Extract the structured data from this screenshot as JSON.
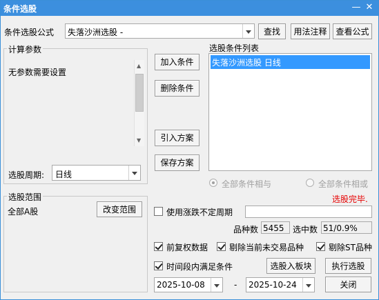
{
  "window": {
    "title": "条件选股",
    "min_icon": "minimize-icon",
    "close_icon": "close-icon"
  },
  "formula": {
    "label": "条件选股公式",
    "value": "失落沙洲选股  -",
    "find_button": "查找",
    "usage_button": "用法注释",
    "view_button": "查看公式"
  },
  "params": {
    "group_label": "计算参数",
    "text": "无参数需要设置",
    "period_label": "选股周期:",
    "period_value": "日线"
  },
  "actions": {
    "add": "加入条件",
    "remove": "删除条件",
    "import": "引入方案",
    "save": "保存方案"
  },
  "conditions": {
    "header": "选股条件列表",
    "items": [
      "失落沙洲选股  日线"
    ],
    "radio_and": "全部条件相与",
    "radio_or": "全部条件相或",
    "status": "选股完毕."
  },
  "range": {
    "group_label": "选股范围",
    "value": "全部A股",
    "change_button": "改变范围"
  },
  "options": {
    "variable_period_label": "使用涨跌不定周期",
    "variable_period_value": "",
    "count_label": "品种数",
    "count_value": "5455",
    "selected_label": "选中数",
    "selected_value": "51/0.9%",
    "fwd_adjust": "前复权数据",
    "exclude_untraded": "剔除当前未交易品种",
    "exclude_st": "剔除ST品种",
    "period_cond": "时间段内满足条件",
    "to_block_button": "选股入板块",
    "run_button": "执行选股",
    "date_from": "2025-10-08",
    "date_sep": "-",
    "date_to": "2025-10-24",
    "close_button": "关闭"
  },
  "colors": {
    "titlebar": "#3c8fde",
    "selection": "#3399ff",
    "status": "#e60000"
  }
}
